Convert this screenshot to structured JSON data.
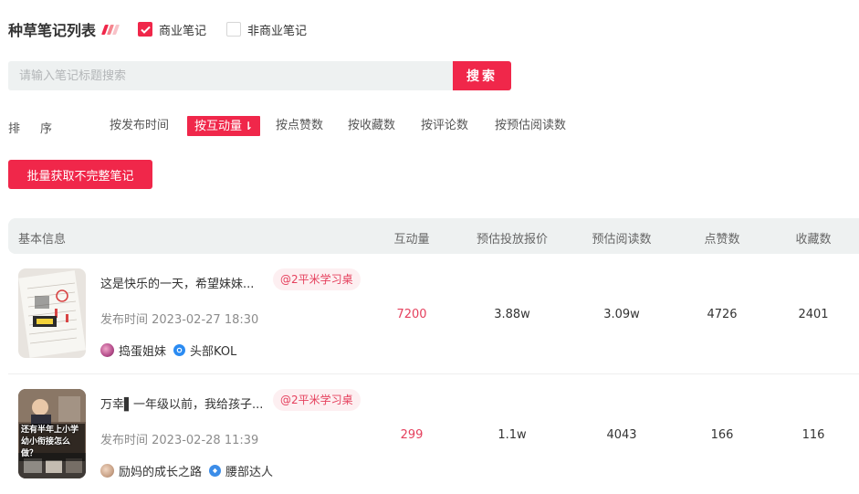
{
  "header": {
    "title": "种草笔记列表",
    "accent_colors": [
      "#f0274a",
      "#f5868f",
      "#f8c2c8"
    ],
    "commercial_label": "商业笔记",
    "commercial_checked": true,
    "noncommercial_label": "非商业笔记",
    "noncommercial_checked": false
  },
  "search": {
    "placeholder": "请输入笔记标题搜索",
    "value": "",
    "button_label": "搜索"
  },
  "sort": {
    "label": "排序",
    "options": [
      {
        "label": "按发布时间",
        "active": false
      },
      {
        "label": "按互动量",
        "active": true
      },
      {
        "label": "按点赞数",
        "active": false
      },
      {
        "label": "按收藏数",
        "active": false
      },
      {
        "label": "按评论数",
        "active": false
      },
      {
        "label": "按预估阅读数",
        "active": false
      }
    ],
    "active_icon": "sort-desc-icon"
  },
  "batch_button": "批量获取不完整笔记",
  "table": {
    "columns": [
      "基本信息",
      "互动量",
      "预估投放报价",
      "预估阅读数",
      "点赞数",
      "收藏数"
    ],
    "rows": [
      {
        "title": "这是快乐的一天，希望妹妹...",
        "tag": "@2平米学习桌",
        "publish_time": "发布时间 2023-02-27 18:30",
        "author": "捣蛋姐妹",
        "author_level": "头部KOL",
        "interactions": "7200",
        "price": "3.88w",
        "reads": "3.09w",
        "likes": "4726",
        "collects": "2401"
      },
      {
        "title": "万幸▌一年级以前，我给孩子...",
        "tag": "@2平米学习桌",
        "publish_time": "发布时间 2023-02-28 11:39",
        "author": "励妈的成长之路",
        "author_level": "腰部达人",
        "interactions": "299",
        "price": "1.1w",
        "reads": "4043",
        "likes": "166",
        "collects": "116",
        "thumb_text": "还有半年上小学 幼小衔接怎么做？"
      }
    ]
  },
  "colors": {
    "brand": "#f0274a",
    "tag_bg": "#fdeff1",
    "header_bg": "#eef1f1"
  }
}
